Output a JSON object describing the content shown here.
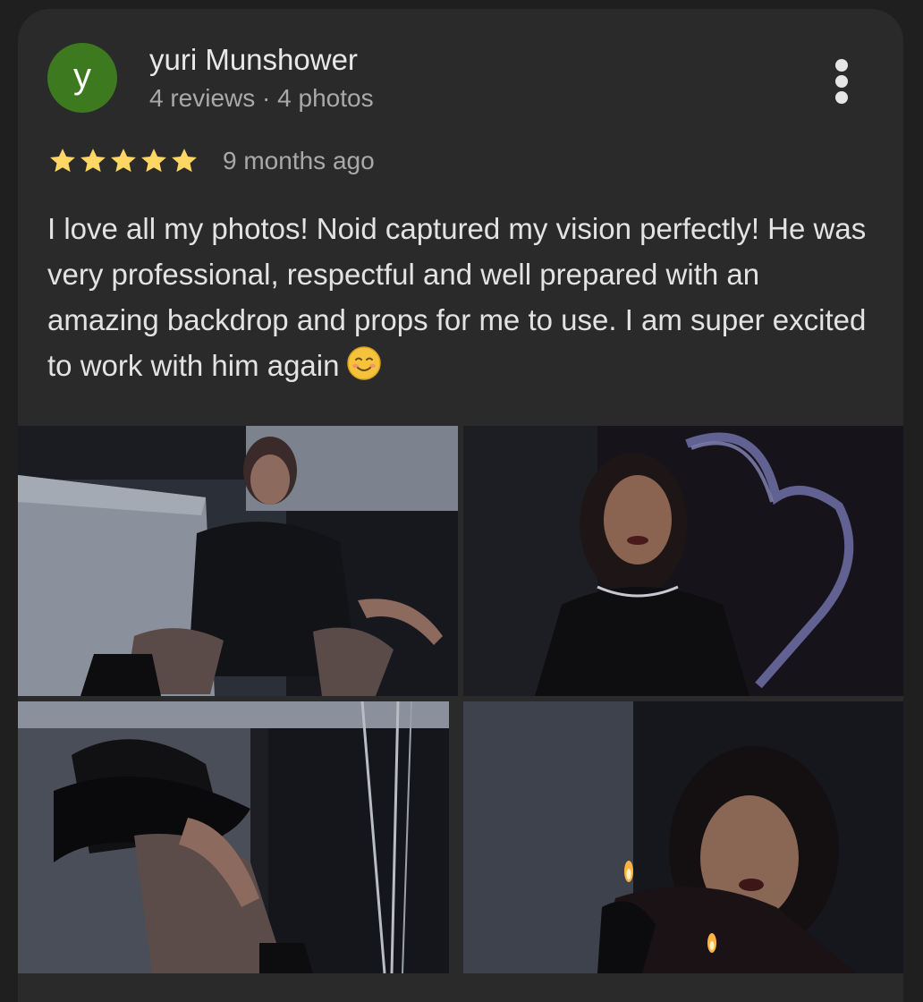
{
  "review": {
    "avatar_initial": "y",
    "author_name": "yuri Munshower",
    "author_meta": "4 reviews · 4 photos",
    "rating": 5,
    "rating_max": 5,
    "time_ago": "9 months ago",
    "text": "I love all my photos! Noid captured my vision perfectly! He was very professional, respectful and well prepared with an amazing backdrop and props for me to use. I am super excited to work with him again",
    "emoji": "smiling-face-icon"
  },
  "colors": {
    "avatar_bg": "#3d7a1f",
    "star": "#fdd663",
    "card_bg": "#2a2a2a"
  },
  "photos": [
    {
      "name": "photo-1",
      "icon": "photo-portrait-seated-icon"
    },
    {
      "name": "photo-2",
      "icon": "photo-portrait-neon-heart-icon"
    },
    {
      "name": "photo-3",
      "icon": "photo-feather-boa-icon"
    },
    {
      "name": "photo-4",
      "icon": "photo-candle-blowing-icon"
    }
  ]
}
